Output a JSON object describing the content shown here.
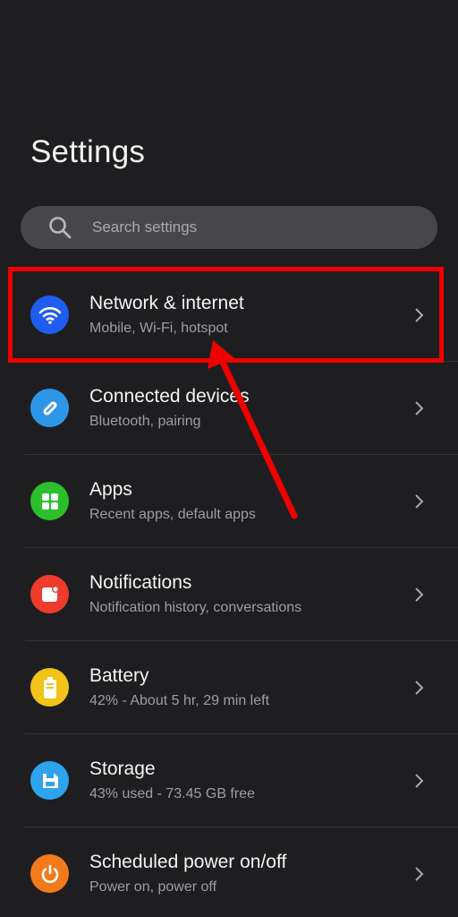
{
  "header": {
    "title": "Settings"
  },
  "search": {
    "placeholder": "Search settings"
  },
  "items": [
    {
      "title": "Network & internet",
      "subtitle": "Mobile, Wi-Fi, hotspot",
      "icon": "wifi-icon",
      "color": "#1f5cf0"
    },
    {
      "title": "Connected devices",
      "subtitle": "Bluetooth, pairing",
      "icon": "connected-devices-icon",
      "color": "#2e96e8"
    },
    {
      "title": "Apps",
      "subtitle": "Recent apps, default apps",
      "icon": "apps-grid-icon",
      "color": "#2bbf2b"
    },
    {
      "title": "Notifications",
      "subtitle": "Notification history, conversations",
      "icon": "notification-icon",
      "color": "#ee3b2b"
    },
    {
      "title": "Battery",
      "subtitle": "42% - About 5 hr, 29 min left",
      "icon": "battery-icon",
      "color": "#f2c318"
    },
    {
      "title": "Storage",
      "subtitle": "43% used - 73.45 GB free",
      "icon": "storage-icon",
      "color": "#2ea3ee"
    },
    {
      "title": "Scheduled power on/off",
      "subtitle": "Power on, power off",
      "icon": "power-icon",
      "color": "#f2791c"
    }
  ],
  "annotation": {
    "highlight_color": "#ee0000"
  }
}
